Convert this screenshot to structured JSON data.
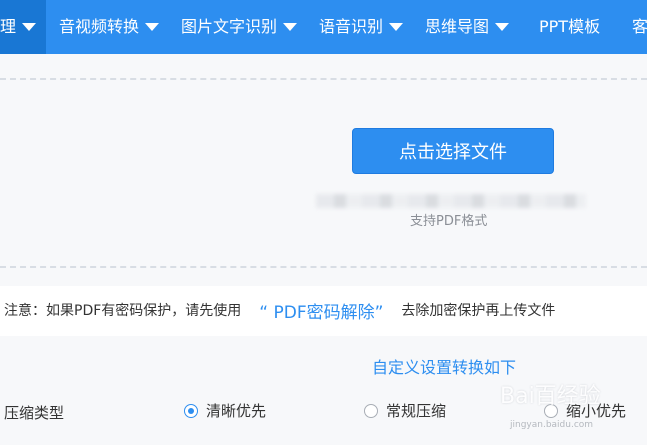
{
  "nav": {
    "items": [
      {
        "label": "理",
        "active": true
      },
      {
        "label": "音视频转换"
      },
      {
        "label": "图片文字识别"
      },
      {
        "label": "语音识别"
      },
      {
        "label": "思维导图"
      },
      {
        "label": "PPT模板"
      },
      {
        "label": "客"
      }
    ]
  },
  "upload": {
    "button_label": "点击选择文件",
    "support_text": "支持PDF格式"
  },
  "notice": {
    "prefix": "注意：如果PDF有密码保护，请先使用",
    "link": "“ PDF密码解除”",
    "suffix": "去除加密保护再上传文件"
  },
  "settings": {
    "title": "自定义设置转换如下",
    "compress_label": "压缩类型",
    "options": [
      {
        "label": "清晰优先",
        "checked": true
      },
      {
        "label": "常规压缩",
        "checked": false
      },
      {
        "label": "缩小优先",
        "checked": false
      }
    ]
  },
  "watermark": {
    "text": "Bai百经验",
    "sub": "jingyan.baidu.com"
  },
  "colors": {
    "accent": "#2d8ef0",
    "nav_active": "#1977d4",
    "panel_bg": "#f7f8fa"
  }
}
